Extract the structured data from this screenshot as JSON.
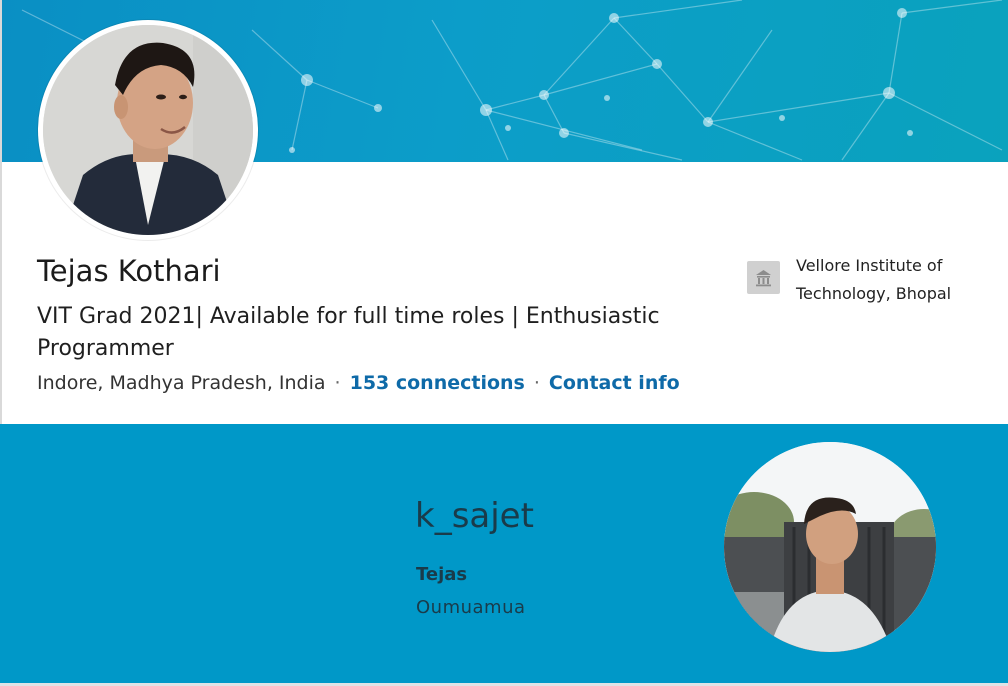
{
  "profile": {
    "name": "Tejas Kothari",
    "headline": "VIT Grad 2021| Available for full time roles | Enthusiastic Programmer",
    "location": "Indore, Madhya Pradesh, India",
    "separator": "·",
    "connections_label": "153 connections",
    "contact_label": "Contact info",
    "education": {
      "name": "Vellore Institute of Technology, Bhopal",
      "logo_icon": "institution-icon"
    },
    "photo": "profile-photo"
  },
  "instagram": {
    "handle": "k_sajet",
    "name": "Tejas",
    "bio": "Oumuamua",
    "photo": "instagram-profile-photo"
  },
  "colors": {
    "banner": "#0a96c6",
    "strip": "#0098c8",
    "link": "#0e6aa8",
    "handle_text": "#1a3b4a"
  }
}
